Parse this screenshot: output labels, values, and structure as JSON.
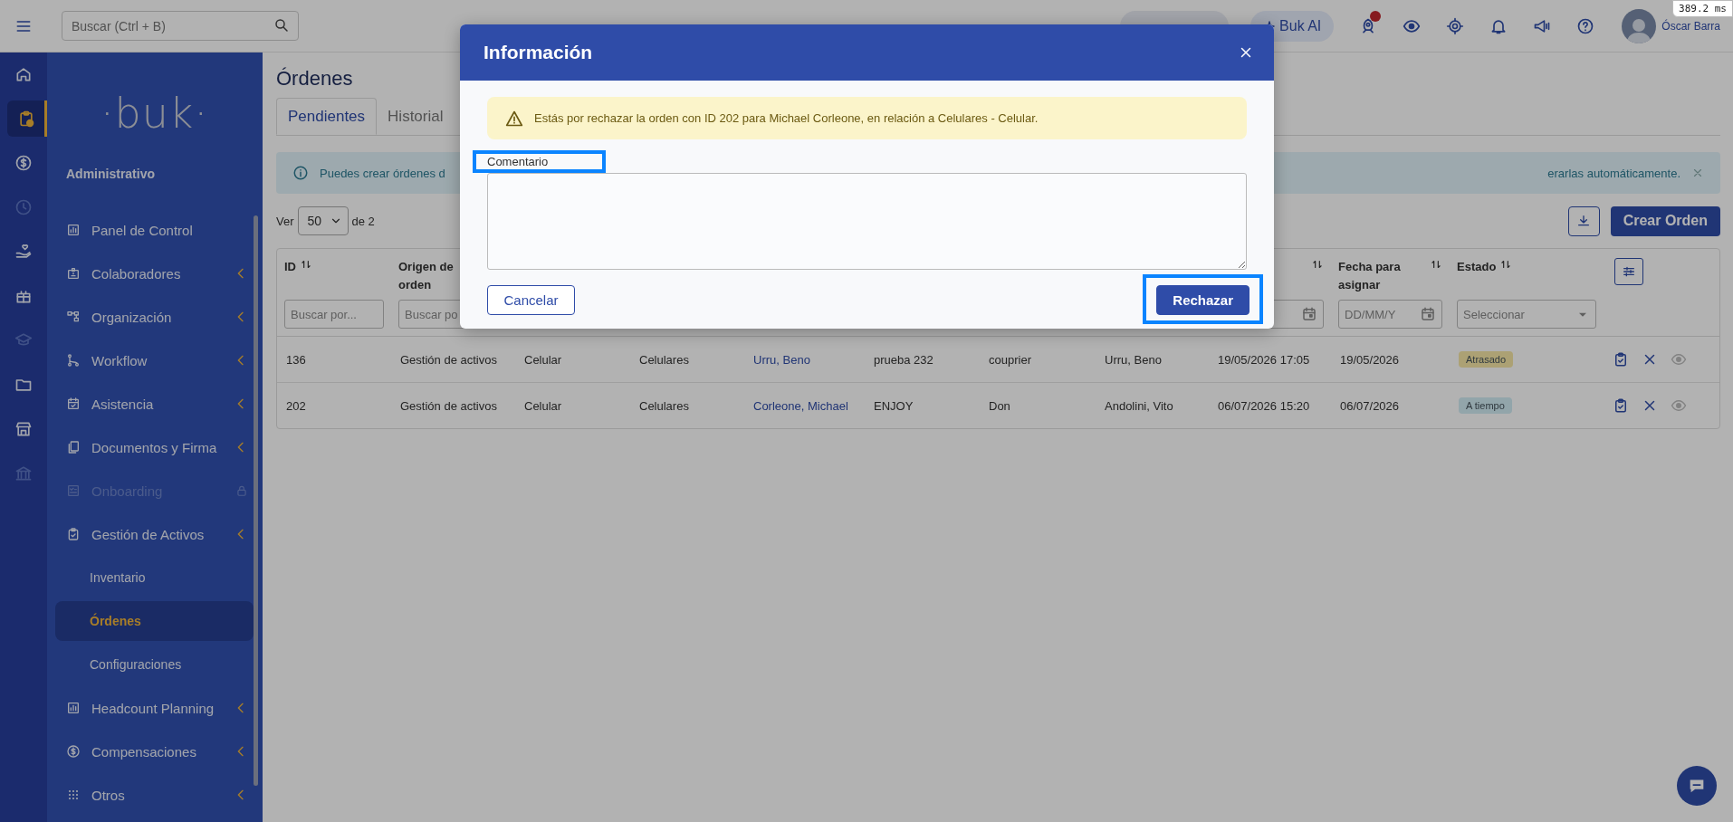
{
  "perf_badge": "389.2 ms",
  "topbar": {
    "search": {
      "placeholder": "Buscar (Ctrl + B)"
    },
    "ai_button": "Buk AI",
    "user_name": "Óscar Barra"
  },
  "icon_rail": [
    {
      "selected": false,
      "disabled": false
    },
    {
      "selected": true,
      "disabled": false
    },
    {
      "selected": false,
      "disabled": false
    },
    {
      "selected": false,
      "disabled": true
    },
    {
      "selected": false,
      "disabled": false
    },
    {
      "selected": false,
      "disabled": false
    },
    {
      "selected": false,
      "disabled": true
    },
    {
      "selected": false,
      "disabled": false
    },
    {
      "selected": false,
      "disabled": false
    },
    {
      "selected": false,
      "disabled": true
    }
  ],
  "sidebar": {
    "logo": "·buk·",
    "section": "Administrativo",
    "items": [
      {
        "label": "Panel de Control",
        "expandable": false,
        "disabled": false
      },
      {
        "label": "Colaboradores",
        "expandable": true,
        "disabled": false
      },
      {
        "label": "Organización",
        "expandable": true,
        "disabled": false
      },
      {
        "label": "Workflow",
        "expandable": true,
        "disabled": false
      },
      {
        "label": "Asistencia",
        "expandable": true,
        "disabled": false
      },
      {
        "label": "Documentos y Firma",
        "expandable": true,
        "disabled": false
      },
      {
        "label": "Onboarding",
        "expandable": false,
        "disabled": true
      },
      {
        "label": "Gestión de Activos",
        "expandable": true,
        "disabled": false,
        "children": [
          {
            "label": "Inventario",
            "selected": false
          },
          {
            "label": "Órdenes",
            "selected": true
          },
          {
            "label": "Configuraciones",
            "selected": false
          }
        ]
      },
      {
        "label": "Headcount Planning",
        "expandable": true,
        "disabled": false
      },
      {
        "label": "Compensaciones",
        "expandable": true,
        "disabled": false
      },
      {
        "label": "Otros",
        "expandable": true,
        "disabled": false
      }
    ]
  },
  "page_title": "Órdenes",
  "tabs": [
    {
      "label": "Pendientes",
      "selected": true
    },
    {
      "label": "Historial",
      "selected": false
    }
  ],
  "info_alert": {
    "text_start": "Puedes crear órdenes d",
    "text_end": "erarlas automáticamente."
  },
  "pager": {
    "prefix": "Ver",
    "page_size": "50",
    "suffix": "de 2"
  },
  "create_button": "Crear Orden",
  "table": {
    "columns": [
      {
        "kind": "text",
        "label": "ID",
        "sortable": true,
        "filter": {
          "kind": "text",
          "placeholder": "Buscar por..."
        }
      },
      {
        "kind": "text",
        "label": "Origen de orden",
        "sortable": false,
        "filter": {
          "kind": "text",
          "placeholder": "Buscar po"
        }
      },
      {
        "kind": "text"
      },
      {
        "kind": "text"
      },
      {
        "kind": "text"
      },
      {
        "kind": "text"
      },
      {
        "kind": "text"
      },
      {
        "kind": "text"
      },
      {
        "kind": "date",
        "sortable": true,
        "filter": {
          "kind": "date"
        }
      },
      {
        "kind": "date",
        "label": "Fecha para asignar",
        "sortable": true,
        "filter": {
          "kind": "date",
          "placeholder": "DD/MM/Y"
        }
      },
      {
        "kind": "status",
        "label": "Estado",
        "sortable": true,
        "filter": {
          "kind": "select",
          "placeholder": "Seleccionar"
        }
      },
      {
        "kind": "actions"
      }
    ],
    "rows": [
      {
        "cells": [
          {
            "text": "136"
          },
          {
            "text": "Gestión de activos"
          },
          {
            "text": "Celular"
          },
          {
            "text": "Celulares"
          },
          {
            "text": "Urru, Beno",
            "kind": "link"
          },
          {
            "text": "prueba 232"
          },
          {
            "text": "couprier"
          },
          {
            "text": "Urru, Beno"
          },
          {
            "text": "19/05/2026 17:05"
          },
          {
            "text": "19/05/2026"
          }
        ],
        "status": {
          "label": "Atrasado",
          "color": "#aca274"
        },
        "actions": [
          {
            "kind": "approve",
            "disabled": false
          },
          {
            "kind": "reject",
            "disabled": false
          },
          {
            "kind": "view",
            "disabled": true
          }
        ]
      },
      {
        "cells": [
          {
            "text": "202"
          },
          {
            "text": "Gestión de activos"
          },
          {
            "text": "Celular"
          },
          {
            "text": "Celulares"
          },
          {
            "text": "Corleone, Michael",
            "kind": "link"
          },
          {
            "text": "ENJOY"
          },
          {
            "text": "Don"
          },
          {
            "text": "Andolini, Vito"
          },
          {
            "text": "06/07/2026 15:20"
          },
          {
            "text": "06/07/2026"
          }
        ],
        "status": {
          "label": "A tiempo",
          "color": "#93a5ab"
        },
        "actions": [
          {
            "kind": "approve",
            "disabled": false
          },
          {
            "kind": "reject",
            "disabled": false
          },
          {
            "kind": "view",
            "disabled": true
          }
        ]
      }
    ]
  },
  "modal": {
    "title": "Información",
    "warning": "Estás por rechazar la orden con ID 202 para Michael Corleone, en relación a Celulares - Celular.",
    "comment": {
      "label": "Comentario",
      "highlighted": true
    },
    "buttons": [
      {
        "label": "Cancelar",
        "kind": "secondary",
        "highlighted": false
      },
      {
        "label": "Rechazar",
        "kind": "primary",
        "highlighted": true
      }
    ]
  }
}
